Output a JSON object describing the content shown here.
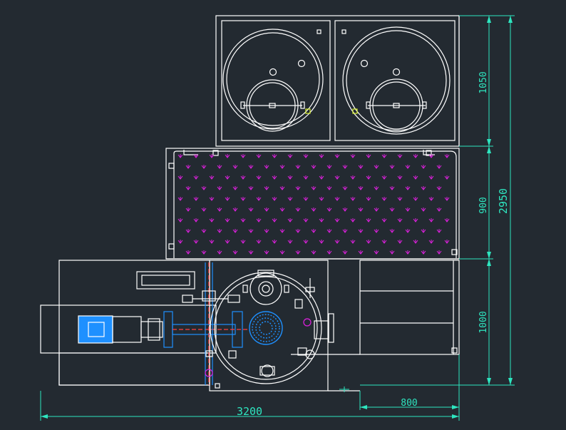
{
  "drawing": {
    "background": "#232a31",
    "line_color": "#ffffff",
    "dimension_color": "#2ee6c0",
    "marker_color": "#e020e0",
    "motor_color": "#1e90ff"
  },
  "dimensions": {
    "total_width": "3200",
    "right_width": "800",
    "total_height": "2950",
    "seg_top": "1050",
    "seg_mid": "900",
    "seg_bottom": "1000"
  }
}
